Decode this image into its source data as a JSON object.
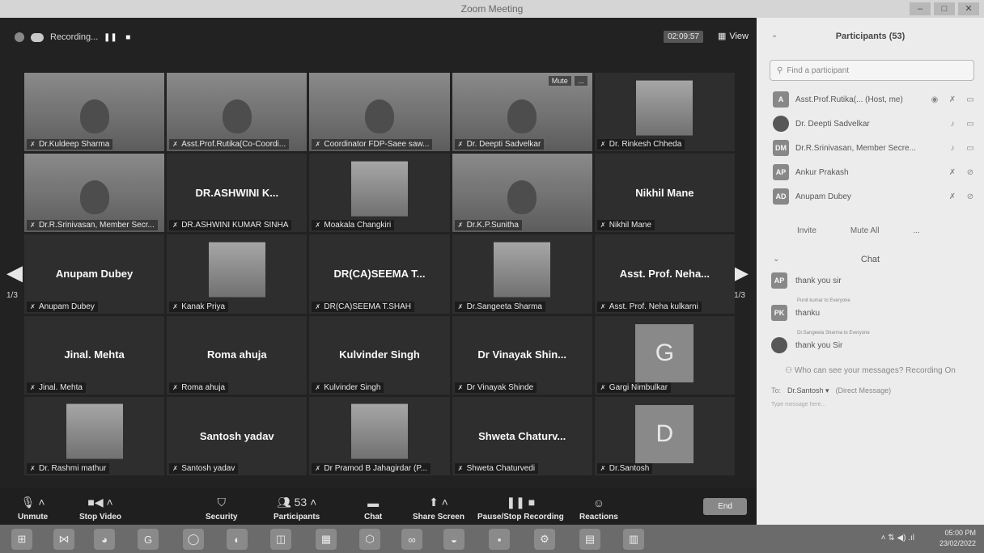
{
  "window": {
    "title": "Zoom Meeting",
    "controls": [
      "–",
      "□",
      "✕"
    ]
  },
  "topbar": {
    "recording_label": "Recording...",
    "timer": "02:09:57",
    "view_label": "View"
  },
  "tiles": [
    {
      "name": "Dr.Kuldeep Sharma",
      "kind": "video",
      "big": ""
    },
    {
      "name": "Asst.Prof.Rutika(Co-Coordi...",
      "kind": "video",
      "big": ""
    },
    {
      "name": "Coordinator FDP-Saee saw...",
      "kind": "video",
      "big": ""
    },
    {
      "name": "Dr. Deepti Sadvelkar",
      "kind": "active",
      "big": "",
      "mute": "Mute",
      "more": "..."
    },
    {
      "name": "Dr. Rinkesh Chheda",
      "kind": "thumb",
      "big": ""
    },
    {
      "name": "Dr.R.Srinivasan, Member Secr...",
      "kind": "video",
      "big": ""
    },
    {
      "name": "DR.ASHWINI KUMAR SINHA",
      "kind": "name",
      "big": "DR.ASHWINI K..."
    },
    {
      "name": "Moakala Changkiri",
      "kind": "thumb",
      "big": ""
    },
    {
      "name": "Dr.K.P.Sunitha",
      "kind": "video",
      "big": ""
    },
    {
      "name": "Nikhil Mane",
      "kind": "name",
      "big": "Nikhil Mane"
    },
    {
      "name": "Anupam Dubey",
      "kind": "name",
      "big": "Anupam Dubey"
    },
    {
      "name": "Kanak Priya",
      "kind": "thumb",
      "big": ""
    },
    {
      "name": "DR(CA)SEEMA T.SHAH",
      "kind": "name",
      "big": "DR(CA)SEEMA T..."
    },
    {
      "name": "Dr.Sangeeta Sharma",
      "kind": "thumb",
      "big": ""
    },
    {
      "name": "Asst. Prof. Neha kulkarni",
      "kind": "name",
      "big": "Asst. Prof. Neha..."
    },
    {
      "name": "Jinal. Mehta",
      "kind": "name",
      "big": "Jinal. Mehta"
    },
    {
      "name": "Roma ahuja",
      "kind": "name",
      "big": "Roma ahuja"
    },
    {
      "name": "Kulvinder Singh",
      "kind": "name",
      "big": "Kulvinder Singh"
    },
    {
      "name": "Dr Vinayak Shinde",
      "kind": "name",
      "big": "Dr Vinayak Shin..."
    },
    {
      "name": "Gargi Nimbulkar",
      "kind": "letter",
      "big": "G"
    },
    {
      "name": "Dr. Rashmi mathur",
      "kind": "thumb",
      "big": ""
    },
    {
      "name": "Santosh yadav",
      "kind": "name",
      "big": "Santosh yadav"
    },
    {
      "name": "Dr Pramod B Jahagirdar (P...",
      "kind": "thumb",
      "big": ""
    },
    {
      "name": "Shweta Chaturvedi",
      "kind": "name",
      "big": "Shweta Chaturv..."
    },
    {
      "name": "Dr.Santosh",
      "kind": "letter",
      "big": "D"
    }
  ],
  "pager": {
    "page": "1/3",
    "left_arrow": "◀",
    "right_arrow": "▶"
  },
  "toolbar": {
    "unmute": "Unmute",
    "stop_video": "Stop Video",
    "security": "Security",
    "participants": "Participants",
    "participants_count": "53",
    "chat": "Chat",
    "share_screen": "Share Screen",
    "pause_recording": "Pause/Stop Recording",
    "reactions": "Reactions",
    "end": "End"
  },
  "side": {
    "participants_title": "Participants (53)",
    "search_placeholder": "Find a participant",
    "participants": [
      {
        "initials": "A",
        "name": "Asst.Prof.Rutika(... (Host, me)"
      },
      {
        "initials": "",
        "name": "Dr. Deepti Sadvelkar"
      },
      {
        "initials": "DM",
        "name": "Dr.R.Srinivasan, Member Secre..."
      },
      {
        "initials": "AP",
        "name": "Ankur Prakash"
      },
      {
        "initials": "AD",
        "name": "Anupam Dubey"
      }
    ],
    "invite": "Invite",
    "mute_all": "Mute All",
    "more": "...",
    "chat_title": "Chat",
    "messages": [
      {
        "from": "",
        "initials": "AP",
        "text": "thank you sir"
      },
      {
        "from": "Punit kumar to Everyone",
        "initials": "PK",
        "text": "thanku"
      },
      {
        "from": "Dr.Sangeeta Sharma to Everyone",
        "initials": "",
        "text": "thank you Sir"
      }
    ],
    "who_can_see": "Who can see your messages? Recording On",
    "to_label": "To:",
    "to_value": "Dr.Santosh ▾",
    "direct_message": "(Direct Message)",
    "type_hint": "Type message here..."
  },
  "taskbar": {
    "time": "05:00 PM",
    "date": "23/02/2022",
    "icons": [
      "⊞",
      "⋈",
      "◕",
      "G",
      "◯",
      "◐",
      "◫",
      "▦",
      "⬡",
      "∞",
      "◒",
      "▪",
      "⚙",
      "▤",
      "▥"
    ]
  }
}
